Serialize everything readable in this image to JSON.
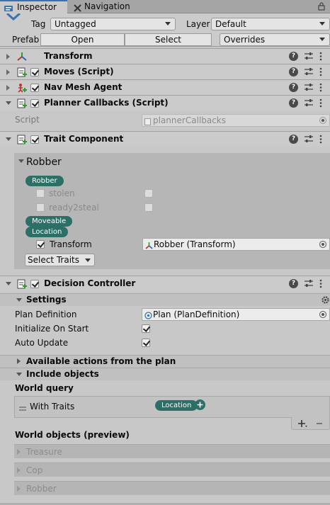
{
  "tabs": {
    "inspector": "Inspector",
    "navigation": "Navigation"
  },
  "header": {
    "tag_label": "Tag",
    "tag_value": "Untagged",
    "layer_label": "Layer",
    "layer_value": "Default",
    "prefab_label": "Prefab",
    "open": "Open",
    "select": "Select",
    "overrides": "Overrides"
  },
  "components": {
    "transform": "Transform",
    "moves": "Moves (Script)",
    "navmesh": "Nav Mesh Agent",
    "planner": "Planner Callbacks (Script)",
    "trait": "Trait Component",
    "decision": "Decision Controller"
  },
  "help_glyph": "?",
  "planner": {
    "script_label": "Script",
    "script_value": "plannerCallbacks"
  },
  "trait": {
    "group_title": "Robber",
    "robber_pill": "Robber",
    "stolen": "stolen",
    "ready2steal": "ready2steal",
    "moveable_pill": "Moveable",
    "location_pill": "Location",
    "transform_label": "Transform",
    "transform_value": "Robber (Transform)",
    "select_traits": "Select Traits"
  },
  "decision": {
    "settings": "Settings",
    "plan_def_label": "Plan Definition",
    "plan_def_value": "Plan (PlanDefinition)",
    "init_label": "Initialize On Start",
    "auto_label": "Auto Update",
    "available_actions": "Available actions from the plan",
    "include_objects": "Include objects",
    "world_query": "World query",
    "with_traits": "With Traits",
    "with_traits_pill": "Location",
    "world_objects": "World objects (preview)",
    "preview_items": [
      "Treasure",
      "Cop",
      "Robber"
    ]
  },
  "colors": {
    "accent_blue": "#3a72b0",
    "pill_teal": "#2c6f66"
  }
}
